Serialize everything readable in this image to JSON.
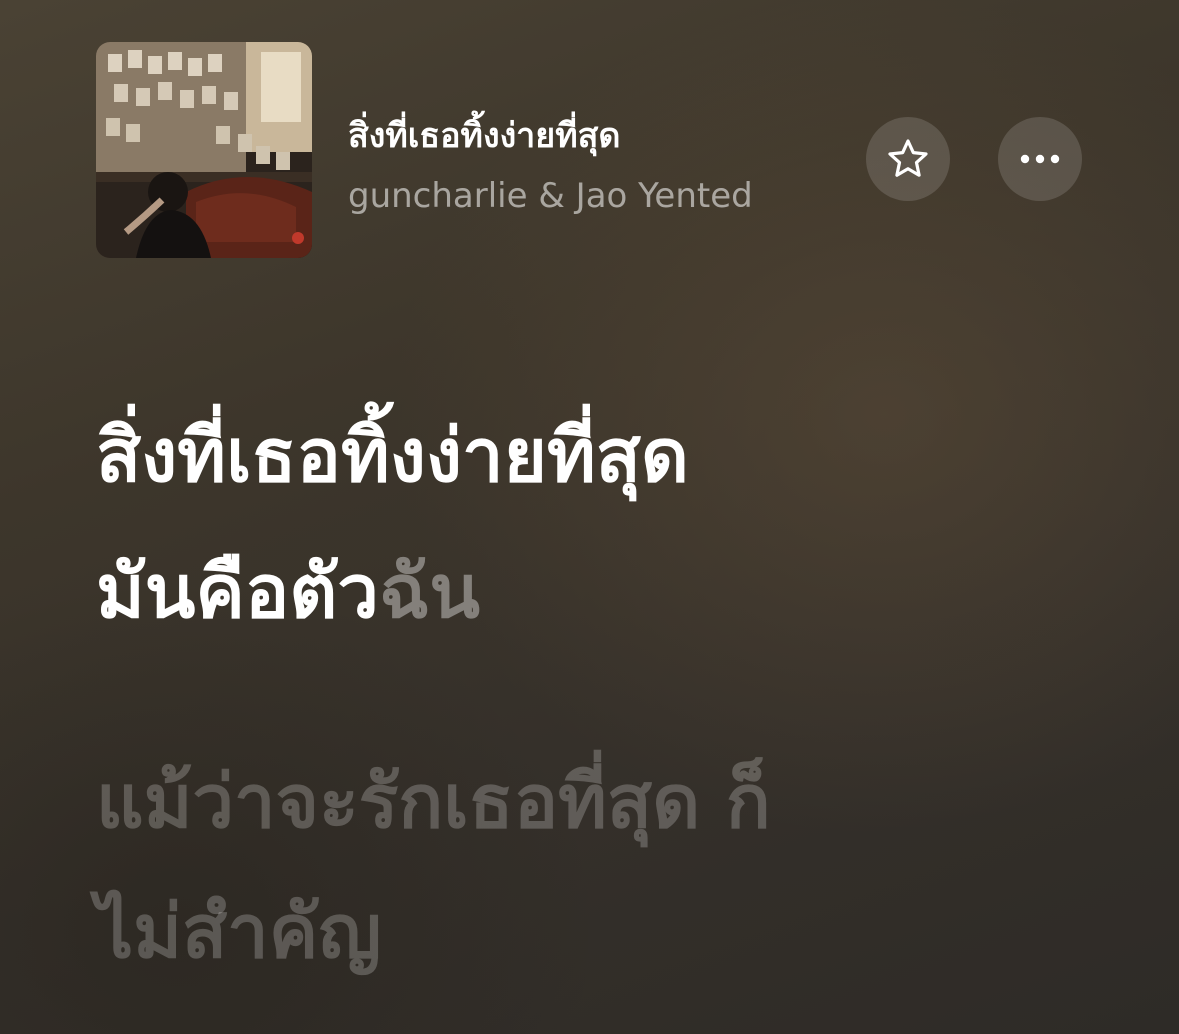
{
  "now_playing": {
    "title": "สิ่งที่เธอทิ้งง่ายที่สุด",
    "artist": "guncharlie & Jao Yented",
    "artwork_icon": "album-artwork"
  },
  "actions": {
    "favorite_icon": "star-icon",
    "more_icon": "more-icon"
  },
  "lyrics": {
    "current_lines": [
      "สิ่งที่เธอทิ้งง่ายที่สุด",
      {
        "sung": "มันคือตัว",
        "unsung": "ฉัน"
      }
    ],
    "next_lines": [
      "แม้ว่าจะรักเธอที่สุด ก็",
      "ไม่สำคัญ"
    ]
  },
  "colors": {
    "background": "#3d362b",
    "active_lyric": "#ffffff",
    "inactive_lyric": "rgba(255,255,255,0.22)"
  }
}
